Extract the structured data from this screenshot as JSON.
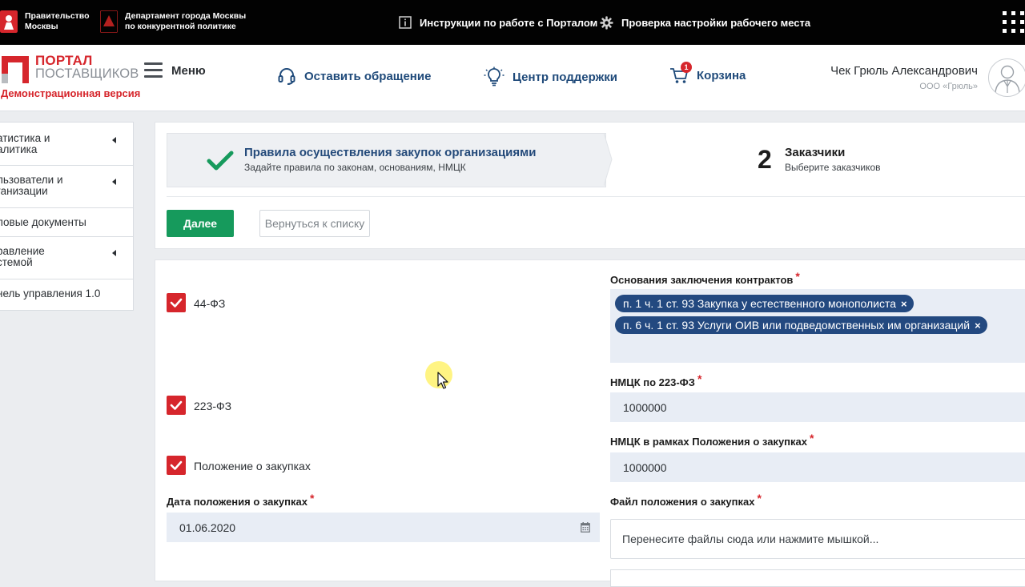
{
  "gov_bar": {
    "gov_label": "Правительство\nМосквы",
    "dept_label": "Департамент города Москвы\nпо конкурентной политике",
    "instructions_link": "Инструкции по работе с Порталом",
    "workplace_check_link": "Проверка настройки рабочего места",
    "gov_icon_color": "#d6262c",
    "dept_icon_color": "#b2201f"
  },
  "header": {
    "logo_top": "ПОРТАЛ",
    "logo_bottom": "ПОСТАВЩИКОВ",
    "demo_label": "Демонстрационная версия",
    "menu_label": "Меню",
    "nav": {
      "appeal": "Оставить обращение",
      "support": "Центр поддержки",
      "cart": "Корзина",
      "cart_count": "1"
    },
    "user_name": "Чек Грюль Александрович",
    "user_org": "ООО «Грюль»",
    "accent_color": "#d6262c",
    "nav_color": "#1f4a7a"
  },
  "sidebar": {
    "items": [
      {
        "label": "атистика и\nалитика",
        "has_arrow": true
      },
      {
        "label": "льзователи и\nганизации",
        "has_arrow": true
      },
      {
        "label": "ловые документы",
        "has_arrow": false
      },
      {
        "label": "равление\nстемой",
        "has_arrow": true
      },
      {
        "label": "нель управления 1.0",
        "has_arrow": false
      }
    ]
  },
  "wizard": {
    "step1": {
      "title": "Правила осуществления закупок организациями",
      "subtitle": "Задайте правила по законам, основаниям, НМЦК",
      "status": "done"
    },
    "step2": {
      "number": "2",
      "title": "Заказчики",
      "subtitle": "Выберите заказчиков"
    },
    "next_button": "Далее",
    "back_button": "Вернуться к списку",
    "success_color": "#169a5c"
  },
  "form": {
    "checkboxes": [
      {
        "label": "44-ФЗ",
        "checked": true
      },
      {
        "label": "223-ФЗ",
        "checked": true
      },
      {
        "label": "Положение о закупках",
        "checked": true
      }
    ],
    "date_field": {
      "label": "Дата положения о закупках",
      "required": "*",
      "value": "01.06.2020"
    },
    "grounds_field": {
      "label": "Основания заключения контрактов",
      "required": "*",
      "tags": [
        "п. 1 ч. 1 ст. 93 Закупка у естественного монополиста",
        "п. 6 ч. 1 ст. 93 Услуги ОИВ или подведомственных им организаций"
      ],
      "remove_glyph": "×"
    },
    "nmck_223_field": {
      "label": "НМЦК по 223-ФЗ",
      "required": "*",
      "value": "1000000"
    },
    "nmck_position_field": {
      "label": "НМЦК в рамках Положения о закупках",
      "required": "*",
      "value": "1000000"
    },
    "file_field": {
      "label": "Файл положения о закупках",
      "required": "*",
      "placeholder": "Перенесите файлы сюда или нажмите мышкой..."
    },
    "checkbox_color": "#d6262c",
    "tag_color": "#234980",
    "input_bg": "#e8edf5"
  },
  "icons": {
    "instructions": "info-square-icon",
    "workplace": "gear-icon",
    "apps": "apps-grid-icon",
    "appeal": "headset-icon",
    "support": "lightbulb-icon",
    "cart": "cart-icon",
    "avatar": "user-avatar-icon",
    "calendar": "calendar-icon",
    "step_done": "checkmark-icon"
  }
}
